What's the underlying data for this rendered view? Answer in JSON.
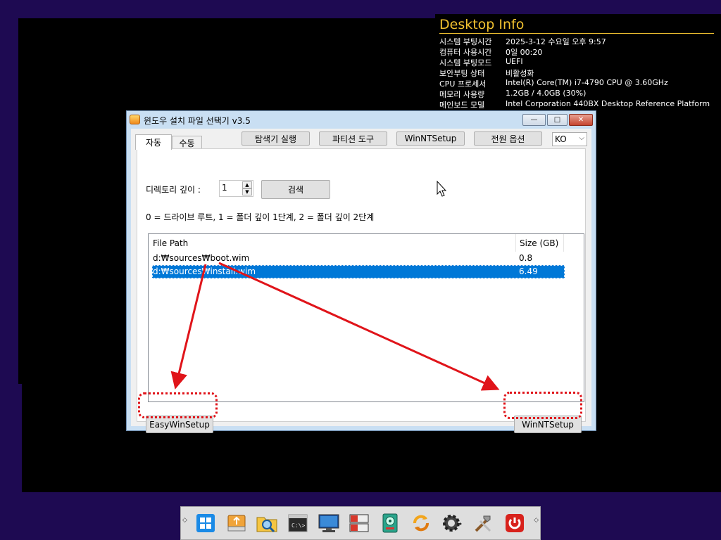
{
  "desktop_info": {
    "title": "Desktop Info",
    "rows": [
      {
        "k": "시스템 부팅시간",
        "v": "2025-3-12 수요일 오후 9:57"
      },
      {
        "k": "컴퓨터 사용시간",
        "v": "0일 00:20"
      },
      {
        "k": "시스템 부팅모드",
        "v": "UEFI"
      },
      {
        "k": "보안부팅 상태",
        "v": "비활성화"
      },
      {
        "k": "CPU 프로세서",
        "v": "Intel(R) Core(TM) i7-4790 CPU @ 3.60GHz"
      },
      {
        "k": "메모리 사용량",
        "v": "1.2GB / 4.0GB (30%)"
      },
      {
        "k": "메인보드 모델",
        "v": "Intel Corporation 440BX Desktop Reference Platform"
      }
    ]
  },
  "window": {
    "title": "윈도우 설치 파일 선택기 v3.5",
    "controls": {
      "minimize": "—",
      "maximize": "□",
      "close": "✕"
    },
    "tabs": [
      {
        "label": "자동"
      },
      {
        "label": "수동"
      }
    ],
    "toolbar": {
      "explorer": "탐색기 실행",
      "partition": "파티션 도구",
      "winntsetup": "WinNTSetup",
      "power": "전원 옵션",
      "language": "KO"
    },
    "depth_label": "디렉토리 깊이 :",
    "depth_value": "1",
    "search_button": "검색",
    "hint": "0 = 드라이브 루트, 1 = 폴더 깊이 1단계, 2 = 폴더 깊이 2단계",
    "list": {
      "columns": [
        "File Path",
        "Size (GB)"
      ],
      "rows": [
        {
          "path": "d:₩sources₩boot.wim",
          "size": "0.8"
        },
        {
          "path": "d:₩sources₩install.wim",
          "size": "6.49"
        }
      ]
    },
    "bottom": {
      "easy": "EasyWinSetup",
      "winnt": "WinNTSetup"
    }
  },
  "accent_colors": {
    "selection": "#0078d7",
    "annotation": "#e0141a",
    "info_title": "#f2c230"
  },
  "taskbar": {
    "icons": [
      "windows-start-icon",
      "usb-drive-icon",
      "explorer-search-icon",
      "cmd-icon",
      "monitor-icon",
      "partition-tool-icon",
      "disk-tool-icon",
      "sync-icon",
      "settings-icon",
      "tools-icon",
      "power-icon"
    ]
  }
}
